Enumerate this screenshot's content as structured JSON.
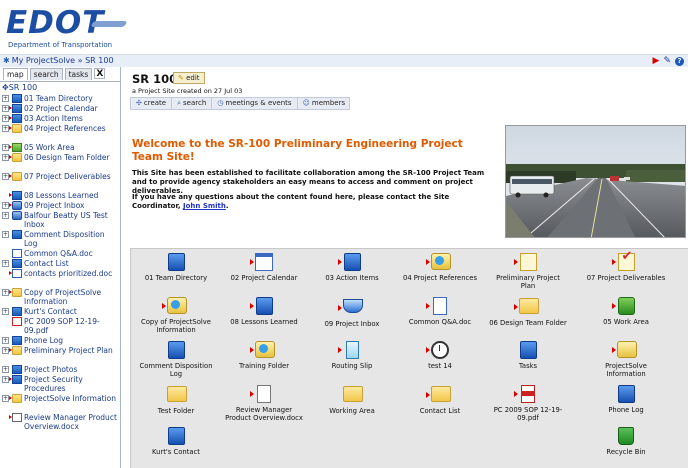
{
  "header": {
    "logo_text": "EDOT",
    "logo_subtitle": "Department of Transportation"
  },
  "breadcrumb": "My ProjectSolve » SR 100",
  "left_pane": {
    "tabs": [
      "map",
      "search",
      "tasks"
    ],
    "close": "X",
    "root_label": "SR 100",
    "items": [
      {
        "label": "01 Team Directory"
      },
      {
        "label": "02 Project Calendar"
      },
      {
        "label": "03 Action Items"
      },
      {
        "label": "04 Project References"
      },
      {
        "label": "05 Work Area"
      },
      {
        "label": "06 Design Team Folder"
      },
      {
        "label": "07 Project Deliverables"
      },
      {
        "label": "08 Lessons Learned"
      },
      {
        "label": "09 Project Inbox"
      },
      {
        "label": "Balfour Beatty US Test Inbox"
      },
      {
        "label": "Comment Disposition Log"
      },
      {
        "label": "Common Q&A.doc"
      },
      {
        "label": "Contact List"
      },
      {
        "label": "contacts prioritized.doc"
      },
      {
        "label": "Copy of ProjectSolve Information"
      },
      {
        "label": "Kurt's Contact"
      },
      {
        "label": "PC 2009 SOP 12-19-09.pdf"
      },
      {
        "label": "Phone Log"
      },
      {
        "label": "Preliminary Project Plan"
      },
      {
        "label": "Project Photos"
      },
      {
        "label": "Project Security Procedures"
      },
      {
        "label": "ProjectSolve Information"
      },
      {
        "label": "Review Manager Product Overview.docx"
      }
    ]
  },
  "main": {
    "site_title": "SR 100",
    "edit_label": "edit",
    "site_subtitle": "a Project Site created on 27 Jul 03",
    "actions": [
      "create",
      "search",
      "meetings & events",
      "members"
    ],
    "welcome_title": "Welcome to the SR-100 Preliminary Engineering Project Team Site!",
    "welcome_p1": "This Site has been established to facilitate collaboration among the SR-100 Project Team and to provide agency stakeholders an easy means to access and comment on project deliverables.",
    "welcome_p2": "If you have any questions about the content found here, please contact the Site Coordinator,",
    "coordinator": "John Smith",
    "period": "."
  },
  "grid_items": [
    {
      "label": "01 Team Directory",
      "icon": "team-directory-icon"
    },
    {
      "label": "02 Project Calendar",
      "icon": "calendar-icon"
    },
    {
      "label": "03 Action Items",
      "icon": "action-items-icon"
    },
    {
      "label": "04 Project References",
      "icon": "references-icon"
    },
    {
      "label": "Preliminary Project Plan",
      "icon": "plan-icon"
    },
    {
      "label": "07 Project Deliverables",
      "icon": "deliverables-icon"
    },
    {
      "label": "Copy of ProjectSolve Information",
      "icon": "info-folder-icon"
    },
    {
      "label": "08 Lessons Learned",
      "icon": "lessons-icon"
    },
    {
      "label": "09 Project Inbox",
      "icon": "inbox-icon"
    },
    {
      "label": "Common Q&A.doc",
      "icon": "word-doc-icon"
    },
    {
      "label": "06 Design Team Folder",
      "icon": "folder-icon"
    },
    {
      "label": "05 Work Area",
      "icon": "work-area-icon"
    },
    {
      "label": "Comment Disposition Log",
      "icon": "log-icon"
    },
    {
      "label": "Training Folder",
      "icon": "training-folder-icon"
    },
    {
      "label": "Routing Slip",
      "icon": "routing-slip-icon"
    },
    {
      "label": "test 14",
      "icon": "clock-icon"
    },
    {
      "label": "Tasks",
      "icon": "tasks-icon"
    },
    {
      "label": "ProjectSolve Information",
      "icon": "info-icon"
    },
    {
      "label": "Test Folder",
      "icon": "folder-icon"
    },
    {
      "label": "Review Manager Product Overview.docx",
      "icon": "document-icon"
    },
    {
      "label": "Working Area",
      "icon": "folder-icon"
    },
    {
      "label": "Contact List",
      "icon": "folder-icon"
    },
    {
      "label": "PC 2009 SOP 12-19-09.pdf",
      "icon": "pdf-icon"
    },
    {
      "label": "Phone Log",
      "icon": "phone-log-icon"
    },
    {
      "label": "Kurt's Contact",
      "icon": "contact-icon"
    },
    {
      "label": "Recycle Bin",
      "icon": "recycle-bin-icon"
    }
  ],
  "colors": {
    "brand": "#1c4fa3",
    "welcome_title": "#e05a00",
    "link": "#2233cc"
  }
}
